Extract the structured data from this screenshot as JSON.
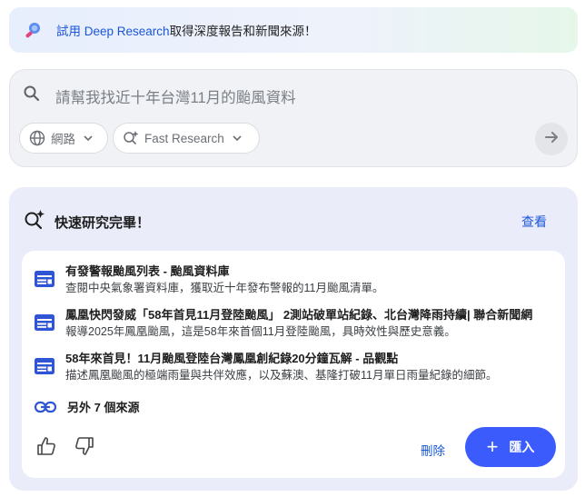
{
  "promo": {
    "link_text": "試用 Deep Research",
    "rest_text": " 取得深度報告和新聞來源！",
    "icon": "telescope-icon"
  },
  "search": {
    "placeholder": "請幫我找近十年台灣11月的颱風資料",
    "source_chip": {
      "label": "網路",
      "icon": "globe-icon"
    },
    "mode_chip": {
      "label": "Fast Research",
      "icon": "sparkle-search-icon"
    },
    "send_icon": "arrow-right-icon"
  },
  "results": {
    "title": "快速研究完畢！",
    "view_label": "查看",
    "sources": [
      {
        "title": "有發警報颱風列表 - 颱風資料庫",
        "description": "查閱中央氣象署資料庫，獲取近十年發布警報的11月颱風清單。"
      },
      {
        "title": "鳳凰快閃發威「58年首見11月登陸颱風」 2測站破單站紀錄、北台灣降雨持續| 聯合新聞網",
        "description": "報導2025年鳳凰颱風，這是58年來首個11月登陸颱風，具時效性與歷史意義。"
      },
      {
        "title": "58年來首見！11月颱風登陸台灣鳳凰創紀錄20分鐘瓦解 - 品觀點",
        "description": "描述鳳凰颱風的極端雨量與共伴效應，以及蘇澳、基隆打破11月單日雨量紀錄的細節。"
      }
    ],
    "more_sources": "另外 7 個來源",
    "delete_label": "刪除",
    "import_label": "匯入"
  },
  "colors": {
    "accent": "#3b5bfd",
    "link": "#1a56db",
    "source_icon": "#2f55d4"
  }
}
